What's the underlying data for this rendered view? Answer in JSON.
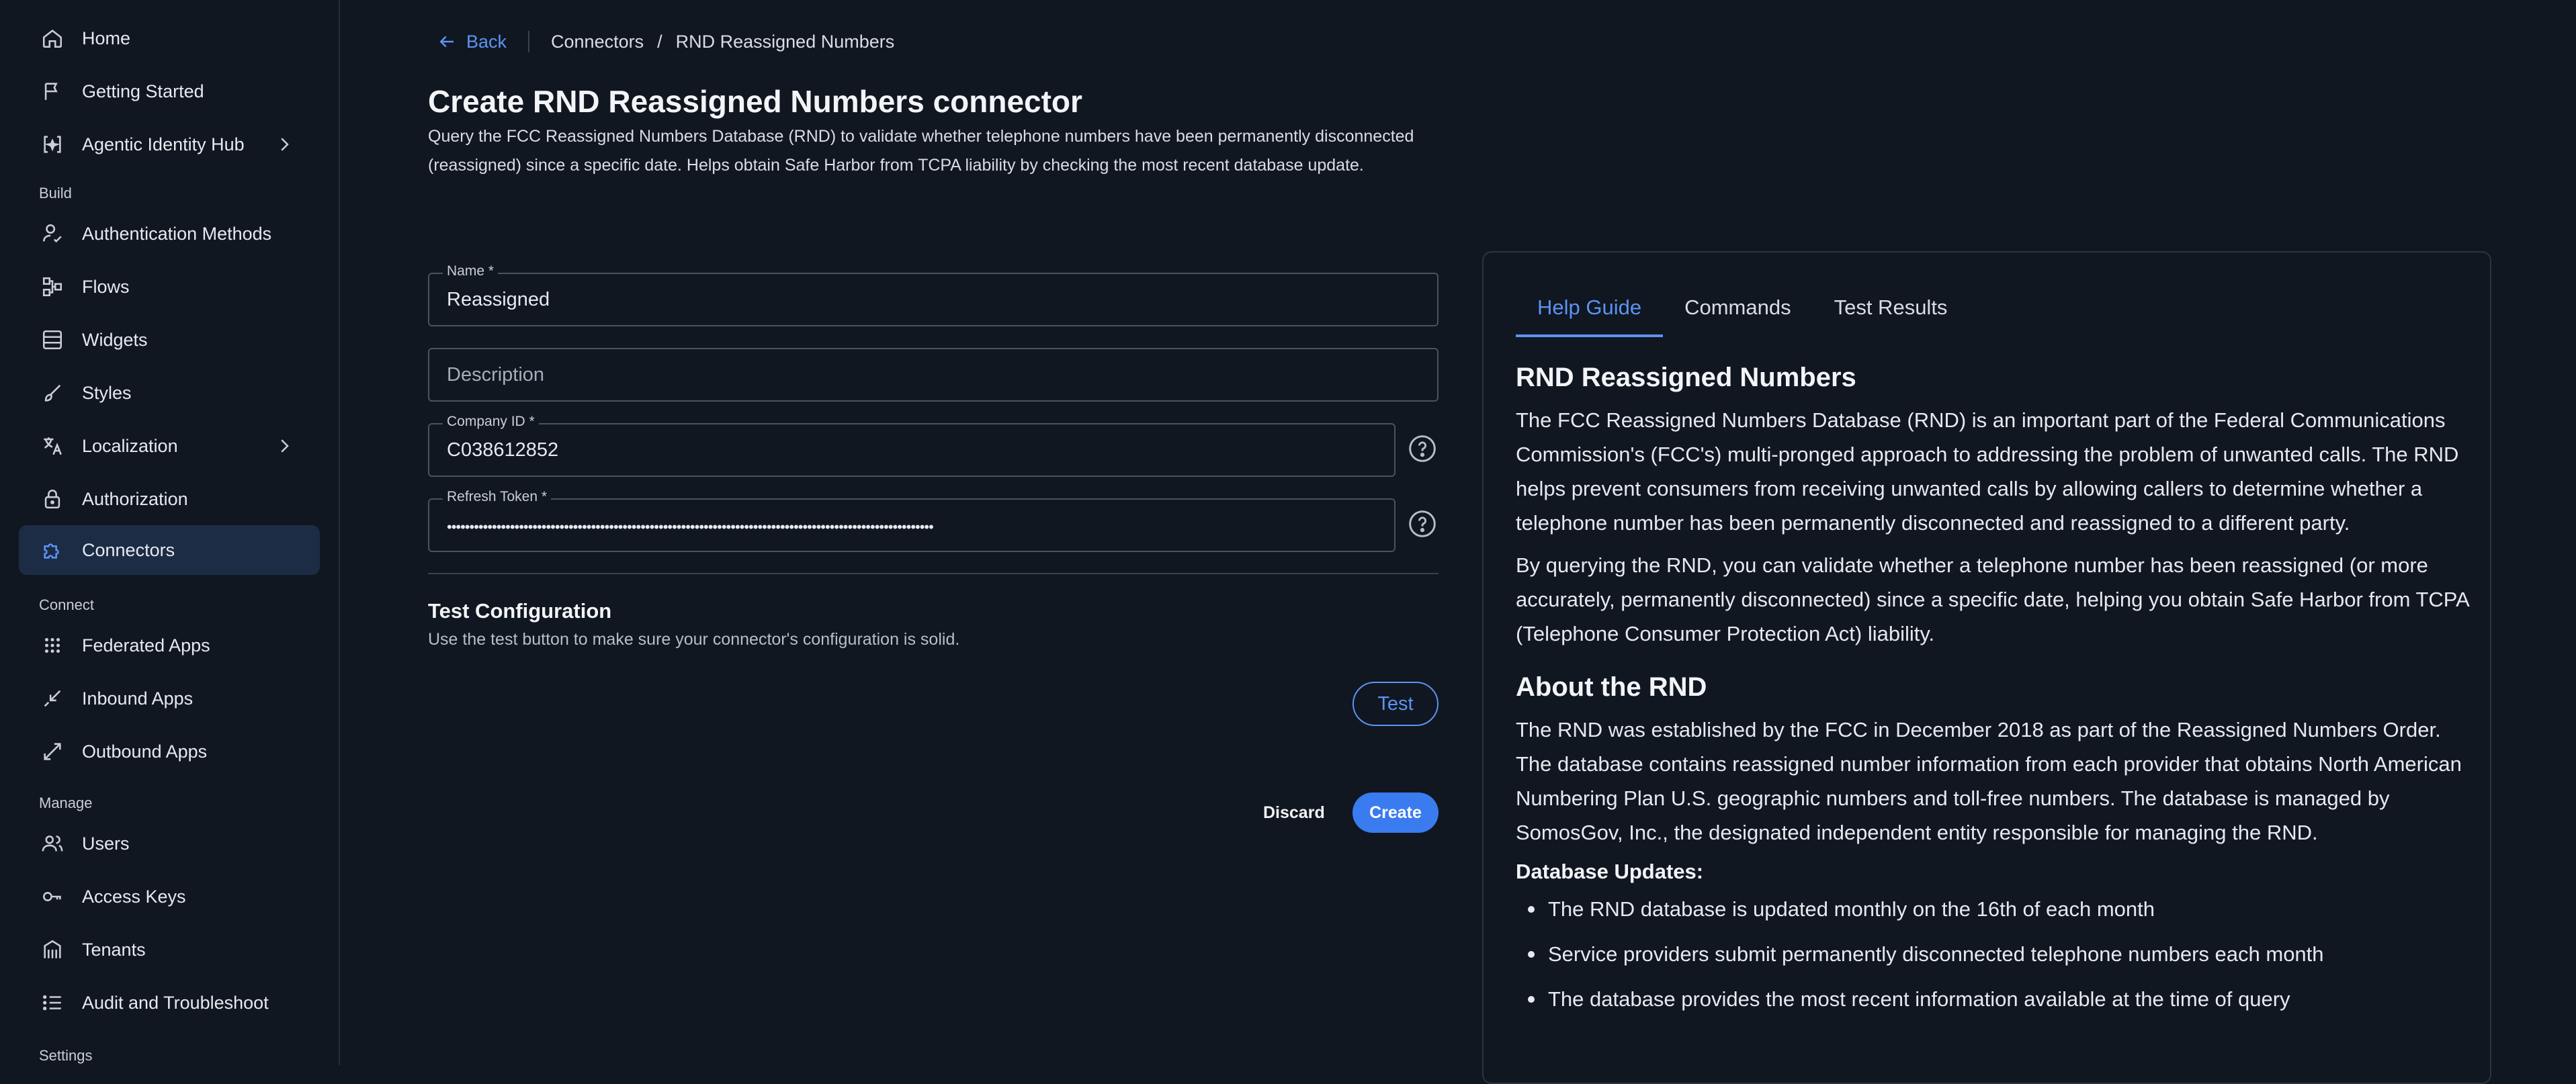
{
  "sidebar": {
    "items": [
      {
        "label": "Home",
        "icon": "home-icon"
      },
      {
        "label": "Getting Started",
        "icon": "flag-icon"
      },
      {
        "label": "Agentic Identity Hub",
        "icon": "agentic-hub-icon"
      },
      {
        "label": "Authentication Methods",
        "icon": "user-check-icon"
      },
      {
        "label": "Flows",
        "icon": "flow-icon"
      },
      {
        "label": "Widgets",
        "icon": "widget-icon"
      },
      {
        "label": "Styles",
        "icon": "brush-icon"
      },
      {
        "label": "Localization",
        "icon": "translate-icon"
      },
      {
        "label": "Authorization",
        "icon": "lock-icon"
      },
      {
        "label": "Connectors",
        "icon": "puzzle-icon"
      },
      {
        "label": "Federated Apps",
        "icon": "grid-icon"
      },
      {
        "label": "Inbound Apps",
        "icon": "inbound-arrow-icon"
      },
      {
        "label": "Outbound Apps",
        "icon": "outbound-arrow-icon"
      },
      {
        "label": "Users",
        "icon": "users-icon"
      },
      {
        "label": "Access Keys",
        "icon": "key-icon"
      },
      {
        "label": "Tenants",
        "icon": "building-icon"
      },
      {
        "label": "Audit and Troubleshoot",
        "icon": "list-icon"
      }
    ],
    "sections": {
      "build": "Build",
      "connect": "Connect",
      "manage": "Manage",
      "settings": "Settings"
    },
    "active_item": "Connectors"
  },
  "breadcrumb": {
    "back": "Back",
    "parent": "Connectors",
    "separator": "/",
    "current": "RND Reassigned Numbers"
  },
  "page": {
    "title": "Create RND Reassigned Numbers connector",
    "description": "Query the FCC Reassigned Numbers Database (RND) to validate whether telephone numbers have been permanently disconnected (reassigned) since a specific date. Helps obtain Safe Harbor from TCPA liability by checking the most recent database update."
  },
  "form": {
    "name": {
      "label": "Name *",
      "value": "Reassigned"
    },
    "description": {
      "placeholder": "Description"
    },
    "company_id": {
      "label": "Company ID *",
      "value": "C038612852"
    },
    "refresh_token": {
      "label": "Refresh Token *",
      "value": "••••••••••••••••••••••••••••••••••••••••••••••••••••••••••••••••••••••••••••••••••••••••••••••••••••••••••••"
    }
  },
  "test_config": {
    "title": "Test Configuration",
    "description": "Use the test button to make sure your connector's configuration is solid.",
    "test_label": "Test"
  },
  "actions": {
    "discard": "Discard",
    "create": "Create"
  },
  "colors": {
    "accent": "#3a7bf0",
    "link": "#5b93f5",
    "background": "#111720",
    "active_nav": "#1d2c45"
  },
  "help": {
    "tabs": [
      "Help Guide",
      "Commands",
      "Test Results"
    ],
    "active_tab": "Help Guide",
    "heading1": "RND Reassigned Numbers",
    "para1": "The FCC Reassigned Numbers Database (RND) is an important part of the Federal Communications Commission's (FCC's) multi-pronged approach to addressing the problem of unwanted calls. The RND helps prevent consumers from receiving unwanted calls by allowing callers to determine whether a telephone number has been permanently disconnected and reassigned to a different party.",
    "para2": "By querying the RND, you can validate whether a telephone number has been reassigned (or more accurately, permanently disconnected) since a specific date, helping you obtain Safe Harbor from TCPA (Telephone Consumer Protection Act) liability.",
    "heading2": "About the RND",
    "para3": "The RND was established by the FCC in December 2018 as part of the Reassigned Numbers Order. The database contains reassigned number information from each provider that obtains North American Numbering Plan U.S. geographic numbers and toll-free numbers. The database is managed by SomosGov, Inc., the designated independent entity responsible for managing the RND.",
    "updates_label": "Database Updates:",
    "bullets": [
      "The RND database is updated monthly on the 16th of each month",
      "Service providers submit permanently disconnected telephone numbers each month",
      "The database provides the most recent information available at the time of query"
    ]
  }
}
